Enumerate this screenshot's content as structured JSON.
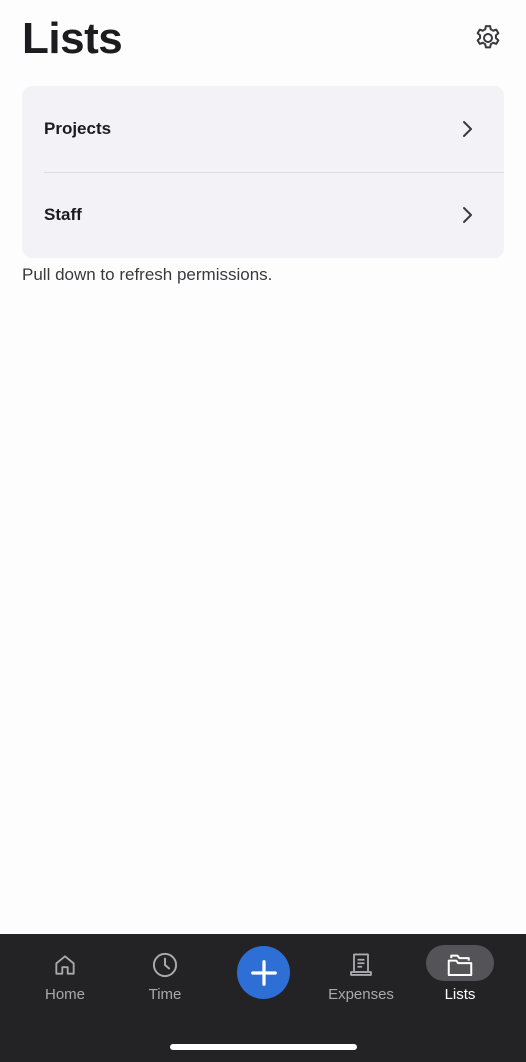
{
  "header": {
    "title": "Lists",
    "settings_icon": "gear-icon"
  },
  "lists": {
    "items": [
      {
        "label": "Projects",
        "icon": "chevron-right-icon"
      },
      {
        "label": "Staff",
        "icon": "chevron-right-icon"
      }
    ]
  },
  "hint": "Pull down to refresh permissions.",
  "tab_bar": {
    "items": [
      {
        "label": "Home",
        "icon": "home-icon"
      },
      {
        "label": "Time",
        "icon": "clock-icon"
      },
      {
        "label": "Expenses",
        "icon": "receipt-icon"
      },
      {
        "label": "Lists",
        "icon": "folder-icon"
      }
    ],
    "add_icon": "plus-icon",
    "active": "Lists"
  },
  "colors": {
    "accent": "#2d6fd4",
    "tab_bar_background": "#232325",
    "card_background": "#f2f2f7"
  }
}
